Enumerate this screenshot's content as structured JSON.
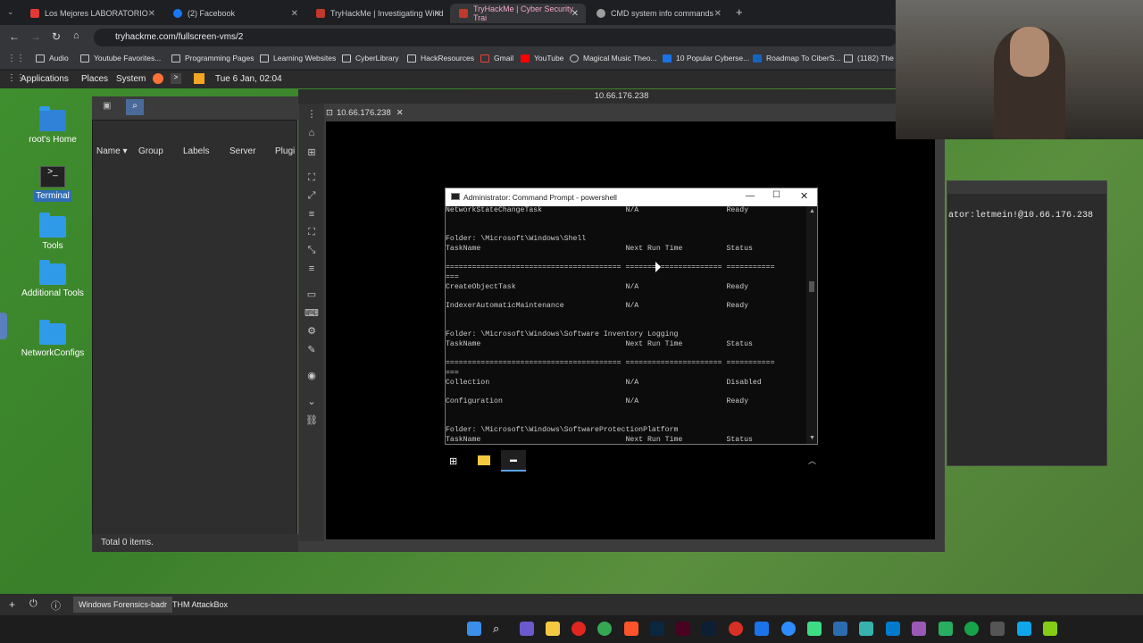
{
  "browser": {
    "tabs": [
      {
        "label": "Los Mejores LABORATORIO",
        "color": "#e53935"
      },
      {
        "label": "(2) Facebook",
        "color": "#1877f2"
      },
      {
        "label": "TryHackMe | Investigating Wind",
        "color": "#c0392b"
      },
      {
        "label": "TryHackMe | Cyber Security Trai",
        "color": "#c0392b"
      },
      {
        "label": "CMD system info commands",
        "color": "#9e9e9e"
      }
    ],
    "url": "tryhackme.com/fullscreen-vms/2",
    "bookmarks": [
      "Audio",
      "Youtube Favorites...",
      "Programming Pages",
      "Learning Websites",
      "CyberLibrary",
      "HackResources",
      "Gmail",
      "YouTube",
      "Magical Music Theo...",
      "10 Popular Cyberse...",
      "Roadmap To CiberS...",
      "(1182) The C"
    ]
  },
  "panel": {
    "applications": "Applications",
    "places": "Places",
    "system": "System",
    "clock": "Tue 6 Jan, 02:04"
  },
  "desktop_icons": [
    "root's Home",
    "Terminal",
    "Tools",
    "Additional Tools",
    "NetworkConfigs"
  ],
  "filemanager": {
    "columns": [
      "Name",
      "Group",
      "Labels",
      "Server",
      "Plugi"
    ],
    "status": "Total 0 items."
  },
  "remmina": {
    "title": "10.66.176.238",
    "tab": "10.66.176.238"
  },
  "cmd": {
    "title": "Administrator: Command Prompt - powershell",
    "lines": [
      "NetworkStateChangeTask                   N/A                    Ready",
      "",
      "",
      "Folder: \\Microsoft\\Windows\\Shell",
      "TaskName                                 Next Run Time          Status",
      "",
      "======================================== ====================== ===========",
      "===",
      "CreateObjectTask                         N/A                    Ready",
      "",
      "IndexerAutomaticMaintenance              N/A                    Ready",
      "",
      "",
      "Folder: \\Microsoft\\Windows\\Software Inventory Logging",
      "TaskName                                 Next Run Time          Status",
      "",
      "======================================== ====================== ===========",
      "===",
      "Collection                               N/A                    Disabled",
      "",
      "Configuration                            N/A                    Ready",
      "",
      "",
      "Folder: \\Microsoft\\Windows\\SoftwareProtectionPlatform",
      "TaskName                                 Next Run Time          Status"
    ]
  },
  "terminal": {
    "text": "ator:letmein!@10.66.176.238"
  },
  "bottom_panel": {
    "items": [
      "Windows Forensics-badr",
      "THM AttackBox"
    ]
  },
  "icons": [
    "menu-icon",
    "power-icon",
    "info-icon",
    "add-icon",
    "windows-start-icon",
    "folder-icon",
    "cmd-icon",
    "chevron-up-icon"
  ]
}
